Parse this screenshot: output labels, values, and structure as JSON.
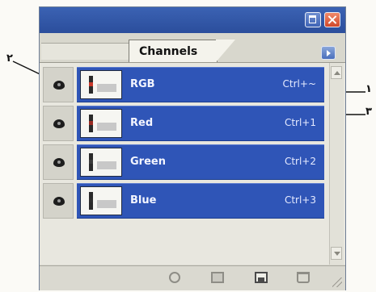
{
  "callouts": {
    "eye_column": "۲",
    "composite_row": "۱",
    "red_row": "۳"
  },
  "panel": {
    "tab_label": "Channels",
    "window_buttons": [
      "minimize-icon",
      "close-icon"
    ],
    "menu_icon": "palette-menu-icon"
  },
  "channels": [
    {
      "name": "RGB",
      "shortcut": "Ctrl+~",
      "visible": true,
      "thumb_dot": "#c8382a"
    },
    {
      "name": "Red",
      "shortcut": "Ctrl+1",
      "visible": true,
      "thumb_dot": "#9a2b22"
    },
    {
      "name": "Green",
      "shortcut": "Ctrl+2",
      "visible": true,
      "thumb_dot": "#3a3a3a"
    },
    {
      "name": "Blue",
      "shortcut": "Ctrl+3",
      "visible": true,
      "thumb_dot": "#2e2e2e"
    }
  ],
  "toolbar_icons": [
    "load-selection-icon",
    "save-selection-icon",
    "new-channel-icon",
    "trash-icon"
  ],
  "colors": {
    "selection": "#2f55b7",
    "title_bar": "#3b62b3"
  }
}
